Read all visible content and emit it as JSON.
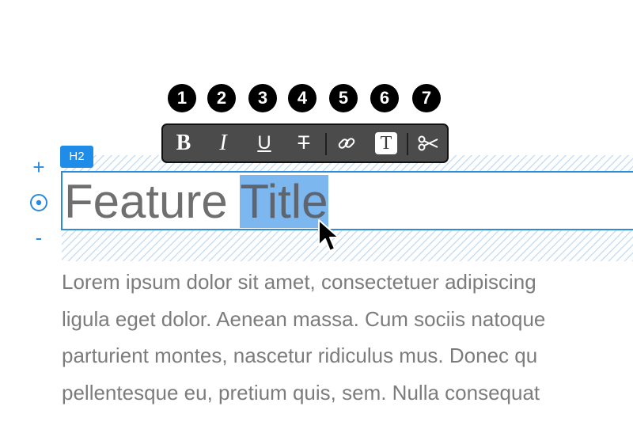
{
  "markers": [
    "1",
    "2",
    "3",
    "4",
    "5",
    "6",
    "7"
  ],
  "toolbar": {
    "buttons": [
      {
        "name": "bold",
        "icon": "bold-icon",
        "glyph": "B"
      },
      {
        "name": "italic",
        "icon": "italic-icon",
        "glyph": "I"
      },
      {
        "name": "underline",
        "icon": "underline-icon",
        "glyph": "U"
      },
      {
        "name": "strikethrough",
        "icon": "strikethrough-icon",
        "glyph": "T"
      },
      {
        "name": "link",
        "icon": "link-icon"
      },
      {
        "name": "clear-formatting",
        "icon": "text-format-icon",
        "glyph": "T"
      },
      {
        "name": "cut",
        "icon": "scissors-icon"
      }
    ]
  },
  "block": {
    "tag": "H2",
    "heading_plain": "Feature ",
    "heading_selected": "Title",
    "add_icon": "plus-icon",
    "target_icon": "target-icon",
    "remove_icon": "minus-icon",
    "add_label": "+",
    "remove_label": "-"
  },
  "body": {
    "lines": [
      "Lorem ipsum dolor sit amet, consectetuer adipiscing",
      "ligula eget dolor. Aenean massa. Cum sociis natoque",
      "parturient montes, nascetur ridiculus mus. Donec qu",
      "pellentesque eu, pretium quis, sem. Nulla consequat"
    ]
  },
  "colors": {
    "accent": "#2a8ae3",
    "badge": "#1f8de7",
    "selection": "#7db7ef",
    "toolbar_bg": "#4b4b4b",
    "heading_text": "#6f6f6f",
    "body_text": "#7c7c7c"
  }
}
